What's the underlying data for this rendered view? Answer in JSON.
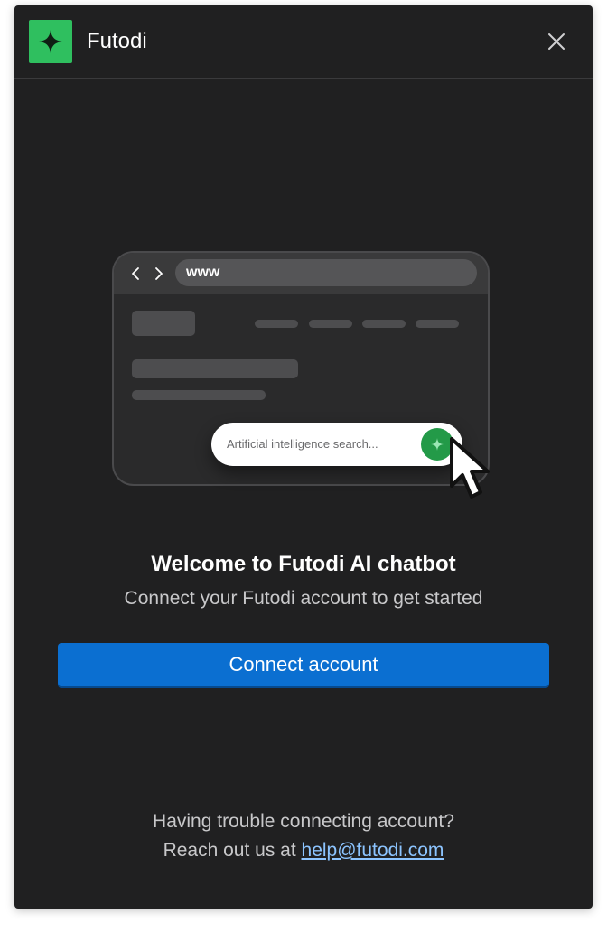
{
  "header": {
    "app_name": "Futodi",
    "logo_icon": "sparkle-icon",
    "close_icon": "close-icon"
  },
  "illustration": {
    "url_text": "www",
    "search_placeholder": "Artificial intelligence search...",
    "search_button_icon": "sparkle-icon",
    "cursor_icon": "pointer-cursor-icon"
  },
  "main": {
    "title": "Welcome to Futodi AI chatbot",
    "subtitle": "Connect your Futodi account to get started",
    "connect_button": "Connect account"
  },
  "help": {
    "line1": "Having trouble connecting account?",
    "line2_prefix": "Reach out us at",
    "email": "help@futodi.com"
  },
  "colors": {
    "panel_bg": "#202021",
    "brand_green": "#2fbf5f",
    "primary_blue": "#0b6fd1",
    "link_blue": "#8cc4ff"
  }
}
